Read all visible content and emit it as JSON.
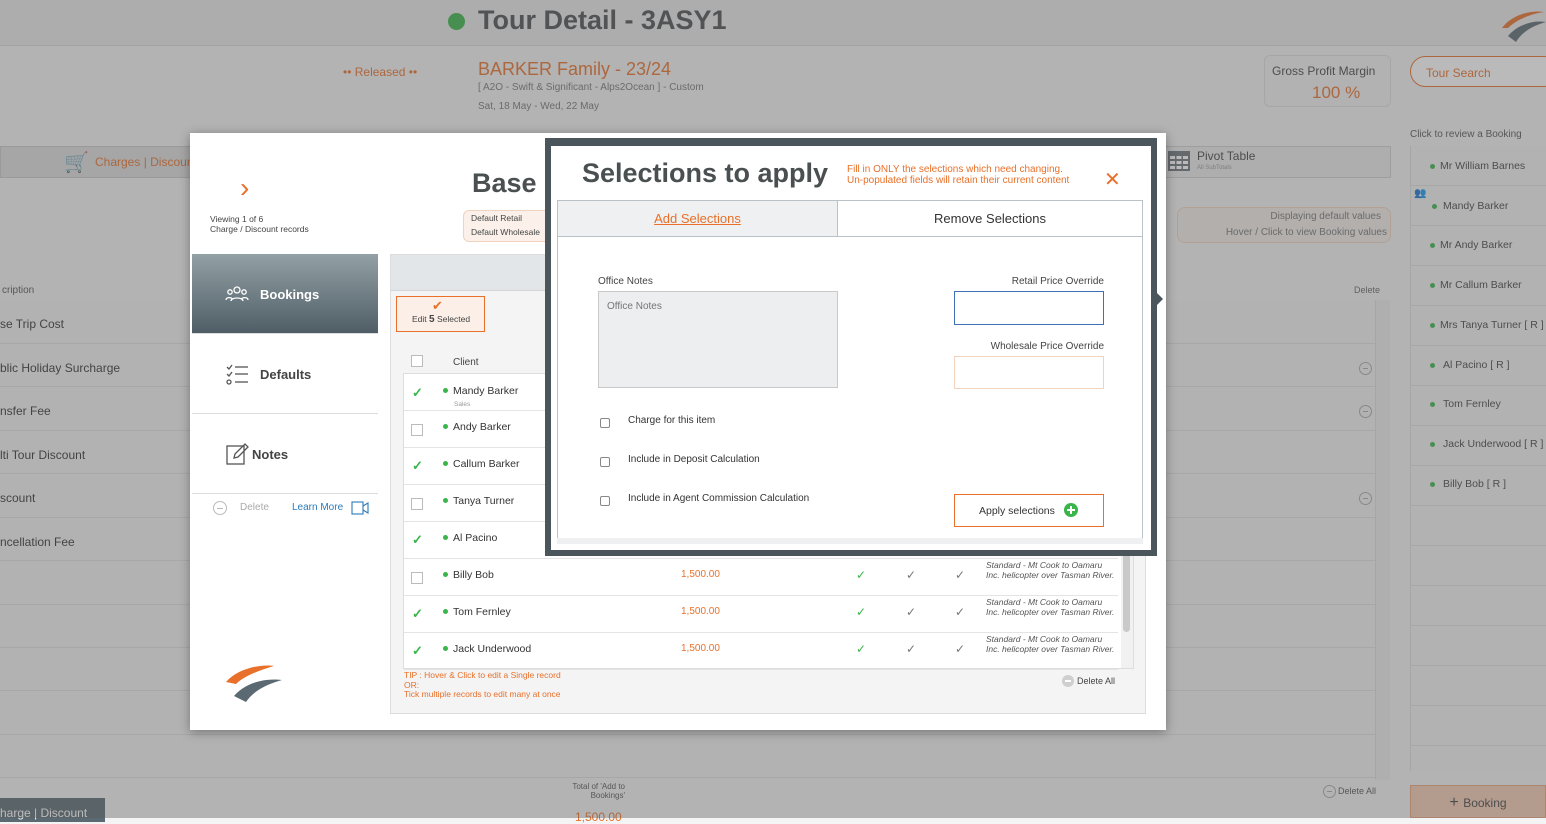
{
  "header": {
    "title": "Tour Detail - 3ASY1",
    "status": "•• Released ••",
    "family": "BARKER Family - 23/24",
    "subtitle": "[ A2O - Swift & Significant - Alps2Ocean ] - Custom",
    "dates": "Sat, 18 May  - Wed, 22 May",
    "gross_profit_label": "Gross Profit Margin",
    "gross_profit_value": "100 %",
    "tour_search": "Tour Search",
    "review_label": "Click to review a Booking"
  },
  "background": {
    "charges_tab": "Charges | Discount",
    "pivot_label": "Pivot Table",
    "pivot_sub": "All SubTotals",
    "default_values_1": "Displaying default values",
    "default_values_2": "Hover / Click to view Booking values",
    "description_header": "cription",
    "delete_header": "Delete",
    "rows": [
      "se Trip Cost",
      "blic Holiday Surcharge",
      "nsfer Fee",
      "lti Tour Discount",
      "scount",
      "ncellation Fee"
    ],
    "total_label": "Total of 'Add to Bookings'",
    "total_value": "1,500.00",
    "delete_all": "Delete All",
    "add_cd_button": "harge | Discount",
    "booking_button": "Booking"
  },
  "bookings_panel": [
    "Mr William Barnes",
    "Mandy Barker",
    "Mr Andy Barker",
    "Mr Callum Barker",
    "Mrs Tanya Turner  [ R ]",
    "Al Pacino  [ R ]",
    "Tom Fernley",
    "Jack Underwood  [ R ]",
    "Billy Bob  [ R ]"
  ],
  "base_modal": {
    "title": "Base",
    "viewing_1": "Viewing 1 of 6",
    "viewing_2": "Charge / Discount records",
    "default_retail": "Default Retail",
    "default_wholesale": "Default Wholesale",
    "nav": {
      "bookings": "Bookings",
      "defaults": "Defaults",
      "notes": "Notes"
    },
    "delete": "Delete",
    "learn_more": "Learn More",
    "edit_prefix": "Edit",
    "edit_count": "5",
    "edit_suffix": "Selected",
    "client_header": "Client",
    "clients": [
      {
        "name": "Mandy Barker",
        "sub": "Sales",
        "checked": true
      },
      {
        "name": "Andy Barker",
        "checked": false
      },
      {
        "name": "Callum Barker",
        "checked": true
      },
      {
        "name": "Tanya Turner",
        "checked": false
      },
      {
        "name": "Al Pacino",
        "checked": true
      },
      {
        "name": "Billy Bob",
        "checked": false,
        "amount": "1,500.00",
        "desc": "Standard - Mt Cook to Oamaru Inc. helicopter over Tasman River."
      },
      {
        "name": "Tom Fernley",
        "checked": true,
        "amount": "1,500.00",
        "desc": "Standard - Mt Cook to Oamaru Inc. helicopter over Tasman River."
      },
      {
        "name": "Jack Underwood",
        "checked": true,
        "amount": "1,500.00",
        "desc": "Standard - Mt Cook to Oamaru Inc. helicopter over Tasman River."
      }
    ],
    "tip_1": "TIP : Hover & Click to edit a Single record",
    "tip_2": "OR:",
    "tip_3": "Tick multiple records to edit many at once",
    "delete_all": "Delete All"
  },
  "selections": {
    "title": "Selections to apply",
    "note_1": "Fill in ONLY the selections which need changing.",
    "note_2": "Un-populated fields will retain their current content",
    "tab_add": "Add Selections",
    "tab_remove": "Remove Selections",
    "office_label": "Office Notes",
    "office_placeholder": "Office Notes",
    "retail_label": "Retail Price Override",
    "wholesale_label": "Wholesale Price Override",
    "opt_charge": "Charge for this item",
    "opt_deposit": "Include in Deposit Calculation",
    "opt_commission": "Include in Agent Commission Calculation",
    "apply": "Apply selections"
  },
  "colors": {
    "accent": "#e8702a",
    "status_green": "#39b54a",
    "frame": "#4a555c"
  }
}
